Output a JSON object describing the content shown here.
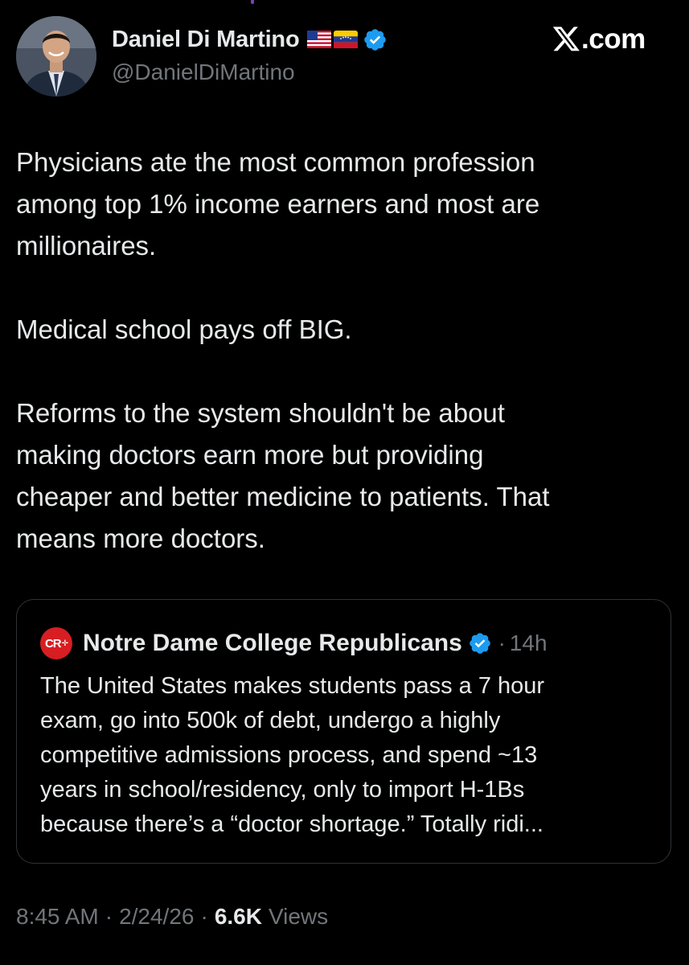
{
  "author": {
    "display_name": "Daniel Di Martino",
    "handle": "@DanielDiMartino",
    "flags": [
      "us-flag-icon",
      "venezuela-flag-icon"
    ],
    "verified": true
  },
  "brand": {
    "site": ".com",
    "logo": "x-logo-icon"
  },
  "tweet": {
    "paragraphs": [
      [
        "Physicians ate the most common profession",
        "among top 1% income earners and most are",
        "millionaires."
      ],
      [
        "Medical school pays off BIG."
      ],
      [
        "Reforms to the system shouldn't be about",
        "making doctors earn more but providing",
        "cheaper and better medicine to patients. That",
        "means more doctors."
      ]
    ]
  },
  "quote": {
    "logo_text": "CR",
    "name": "Notre Dame College Republicans",
    "verified": true,
    "separator": "·",
    "time": "14h",
    "lines": [
      "The United States makes students pass a 7 hour",
      "exam, go into 500k of debt, undergo a highly",
      "competitive admissions process, and spend ~13",
      "years in school/residency, only to import H-1Bs",
      "because there’s a “doctor shortage.” Totally ridi..."
    ]
  },
  "meta": {
    "time": "8:45 AM",
    "separator": "·",
    "date": "2/24/26",
    "views_count": "6.6K",
    "views_label": "Views"
  },
  "colors": {
    "background": "#000000",
    "text": "#e7e9ea",
    "muted": "#71767b",
    "verified_blue": "#1d9bf0",
    "card_border": "#2f3336",
    "cr_red": "#d71e22"
  }
}
